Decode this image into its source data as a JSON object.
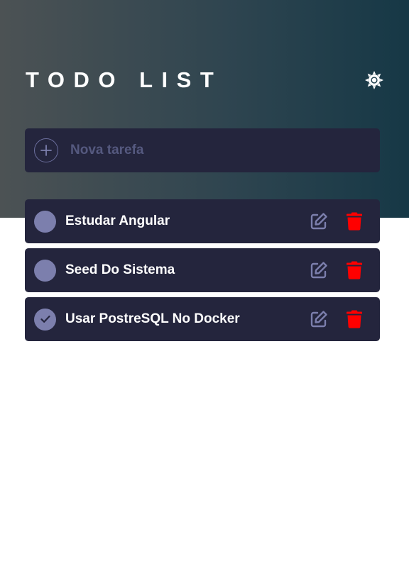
{
  "header": {
    "title": "TODO LIST",
    "theme_icon": "sun-icon"
  },
  "new_task": {
    "placeholder": "Nova tarefa",
    "add_icon": "plus-icon"
  },
  "tasks": [
    {
      "label": "Estudar Angular",
      "completed": false
    },
    {
      "label": "Seed Do Sistema",
      "completed": false
    },
    {
      "label": "Usar PostreSQL No Docker",
      "completed": true
    }
  ],
  "icons": {
    "edit": "pencil-square-icon",
    "delete": "trash-icon"
  },
  "colors": {
    "card_bg": "#24253d",
    "check_bg": "#7c7fad",
    "edit_icon": "#7c7fad",
    "delete_icon": "#ff0000",
    "placeholder": "#55597f"
  }
}
